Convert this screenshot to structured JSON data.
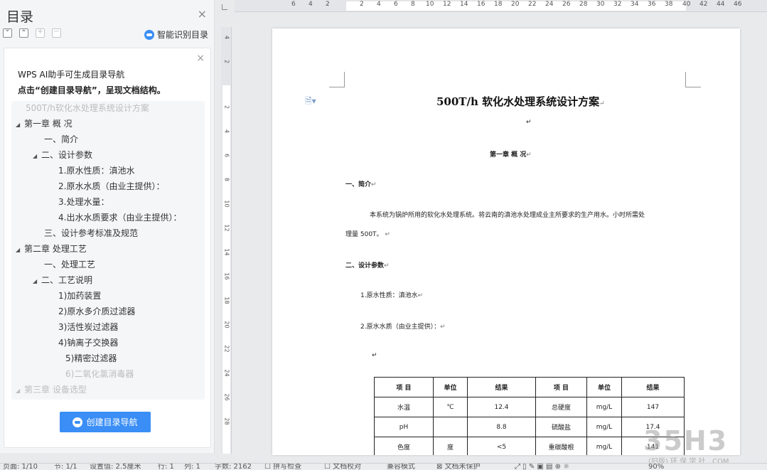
{
  "toc_pane": {
    "title": "目录",
    "close_glyph": "×",
    "smart_toc_label": "智能识别目录"
  },
  "ai_card": {
    "close_glyph": "×",
    "line1": "WPS AI助手可生成目录导航",
    "line2": "点击“创建目录导航”，呈现文档结构。",
    "outline": [
      {
        "label": "500T/h软化水处理系统设计方案",
        "faded": true
      },
      {
        "label": "第一章  概 况",
        "tri": "◢"
      },
      {
        "label": "一、简介"
      },
      {
        "label": "二、设计参数",
        "tri": "◢"
      },
      {
        "label": "1.原水性质：滇池水"
      },
      {
        "label": "2.原水水质（由业主提供）："
      },
      {
        "label": "3.处理水量："
      },
      {
        "label": "4.出水水质要求（由业主提供）："
      },
      {
        "label": "三、设计参考标准及规范"
      },
      {
        "label": "第二章  处理工艺",
        "tri": "◢"
      },
      {
        "label": "一、处理工艺"
      },
      {
        "label": "二、工艺说明",
        "tri": "◢"
      },
      {
        "label": "1)加药装置"
      },
      {
        "label": "2)原水多介质过滤器"
      },
      {
        "label": "3)活性炭过滤器"
      },
      {
        "label": "4)钠离子交换器"
      },
      {
        "label": "5)精密过滤器"
      },
      {
        "label": "6)二氧化氯消毒器",
        "faded": true
      },
      {
        "label": "第三章 设备选型",
        "tri": "◢",
        "faded": true
      }
    ],
    "create_button_label": "创建目录导航"
  },
  "ruler": {
    "h_ticks": [
      "6",
      "4",
      "2",
      "2",
      "4",
      "6",
      "8",
      "10",
      "12",
      "14",
      "16",
      "18",
      "20",
      "22",
      "24",
      "26",
      "28",
      "30",
      "32",
      "34",
      "36",
      "38",
      "40",
      "42",
      "44",
      "46"
    ],
    "v_ticks": [
      "4",
      "2",
      "2",
      "4",
      "6",
      "8",
      "10",
      "12",
      "14",
      "16",
      "18",
      "20",
      "22",
      "24",
      "26",
      "28"
    ]
  },
  "document": {
    "title": "500T/h 软化水处理系统设计方案",
    "para_mark": "↵",
    "chapter1": "第一章   概 况",
    "sec1": "一、简介",
    "body1a": "本系统为锅炉所用的软化水处理系统。将云南的滇池水处理成业主所要求的生产用水。小时所需处",
    "body1b": "理量 500T。",
    "sec2": "二、设计参数",
    "item1": "1.原水性质：滇池水",
    "item2": "2.原水水质（由业主提供）：",
    "table": {
      "headers": [
        "项 目",
        "单位",
        "结果",
        "项 目",
        "单位",
        "结果"
      ],
      "rows": [
        [
          "水温",
          "℃",
          "12.4",
          "总硬度",
          "mg/L",
          "147"
        ],
        [
          "pH",
          "",
          "8.8",
          "硫酸盐",
          "mg/L",
          "17.4"
        ],
        [
          "色度",
          "度",
          "<5",
          "重碳酸根",
          "mg/L",
          "141"
        ]
      ]
    }
  },
  "statusbar": {
    "page": "页面: 1/10",
    "section": "节: 1/1",
    "setting": "设置值: 2.5厘米",
    "row": "行: 1",
    "col": "列: 1",
    "words": "字数: 2162",
    "spell": "拼写检查",
    "proof": "文档校对",
    "compat": "兼容模式",
    "protect": "文档未保护",
    "zoom": "90%"
  },
  "watermark": {
    "main": "35H3",
    "sub": "(旧版) 环 保 学 社 . COM"
  }
}
